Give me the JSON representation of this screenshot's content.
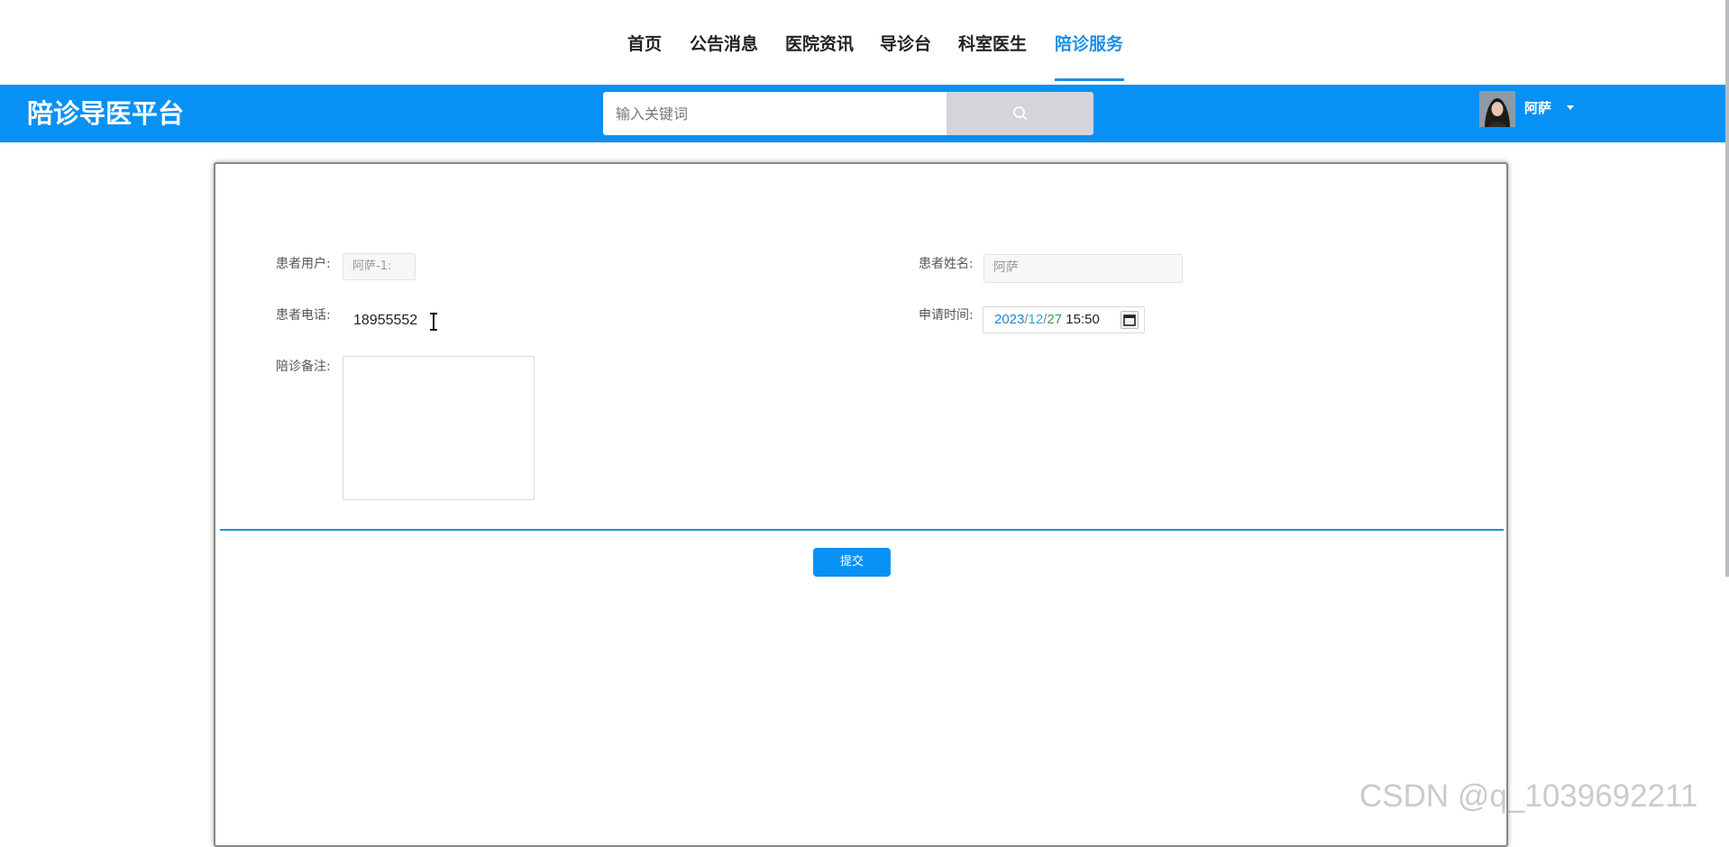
{
  "nav": {
    "items": [
      {
        "label": "首页"
      },
      {
        "label": "公告消息"
      },
      {
        "label": "医院资讯"
      },
      {
        "label": "导诊台"
      },
      {
        "label": "科室医生"
      },
      {
        "label": "陪诊服务",
        "active": true
      }
    ]
  },
  "header": {
    "brand": "陪诊导医平台",
    "search_placeholder": "输入关键词",
    "search_icon": "search-icon",
    "username": "阿萨",
    "avatar": "user-avatar"
  },
  "form": {
    "patient_user_label": "患者用户:",
    "patient_user_value": "阿萨-1:",
    "patient_name_label": "患者姓名:",
    "patient_name_value": "阿萨",
    "phone_label": "患者电话:",
    "phone_value": "18955552",
    "apply_time_label": "申请时间:",
    "apply_time": {
      "year": "2023",
      "sep": "/",
      "month": "12",
      "day": "27",
      "time": "15:50"
    },
    "note_label": "陪诊备注:",
    "note_value": "",
    "submit_label": "提交"
  },
  "watermark": "CSDN @q_1039692211",
  "colors": {
    "accent": "#0891f5",
    "nav_active": "#1e90e6"
  }
}
